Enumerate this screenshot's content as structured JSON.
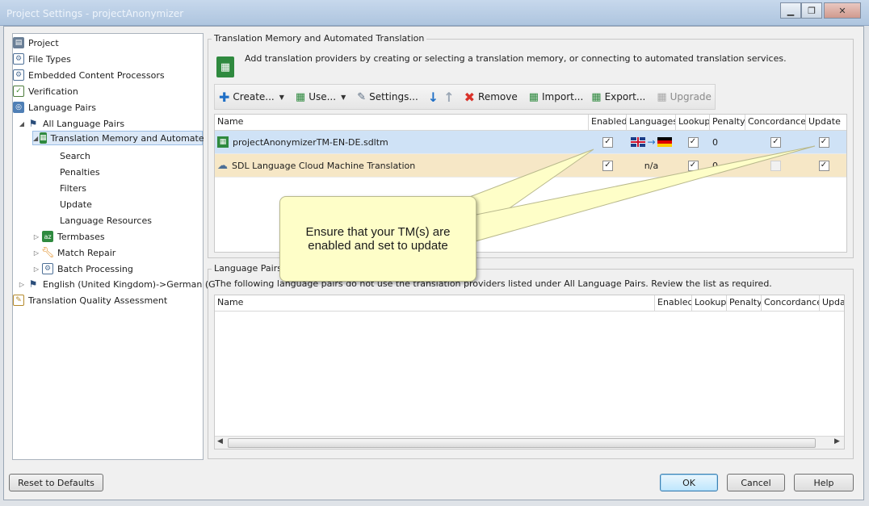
{
  "window": {
    "title": "Project Settings - projectAnonymizer",
    "controls": [
      "minimize",
      "restore",
      "close"
    ]
  },
  "tree": {
    "items": [
      {
        "label": "Project",
        "icon": "project-icon"
      },
      {
        "label": "File Types",
        "icon": "file-types-icon"
      },
      {
        "label": "Embedded Content Processors",
        "icon": "embedded-content-icon"
      },
      {
        "label": "Verification",
        "icon": "verification-icon"
      },
      {
        "label": "Language Pairs",
        "icon": "language-pairs-icon"
      },
      {
        "label": "All Language Pairs",
        "icon": "flag-icon"
      },
      {
        "label": "Translation Memory and Automate",
        "icon": "tm-icon"
      },
      {
        "label": "Search"
      },
      {
        "label": "Penalties"
      },
      {
        "label": "Filters"
      },
      {
        "label": "Update"
      },
      {
        "label": "Language Resources"
      },
      {
        "label": "Termbases",
        "icon": "termbase-icon"
      },
      {
        "label": "Match Repair",
        "icon": "wrench-icon"
      },
      {
        "label": "Batch Processing",
        "icon": "batch-icon"
      },
      {
        "label": "English (United Kingdom)->German (G",
        "icon": "flag-icon"
      },
      {
        "label": "Translation Quality Assessment",
        "icon": "quality-icon"
      }
    ]
  },
  "tm_section": {
    "title": "Translation Memory and Automated Translation",
    "description": "Add translation providers by creating or selecting a translation memory, or connecting to automated translation services.",
    "toolbar": {
      "create": "Create...",
      "use": "Use...",
      "settings": "Settings...",
      "remove": "Remove",
      "import": "Import...",
      "export": "Export...",
      "upgrade": "Upgrade"
    },
    "columns": [
      "Name",
      "Enabled",
      "Languages",
      "Lookup",
      "Penalty",
      "Concordance",
      "Update"
    ],
    "rows": [
      {
        "name": "projectAnonymizerTM-EN-DE.sdltm",
        "enabled": "✓",
        "languages": "",
        "lookup": "✓",
        "penalty": "0",
        "concordance": "✓",
        "update": "✓"
      },
      {
        "name": "SDL Language Cloud Machine Translation",
        "enabled": "✓",
        "languages": "n/a",
        "lookup": "✓",
        "penalty": "0",
        "concordance": "",
        "update": "✓"
      }
    ]
  },
  "lp_section": {
    "title": "Language Pairs",
    "description": "The following language pairs do not use the translation providers listed under All Language Pairs. Review the list as required.",
    "columns": [
      "Name",
      "Enabled",
      "Lookup",
      "Penalty",
      "Concordance",
      "Upda"
    ]
  },
  "callout": {
    "text": "Ensure that your TM(s) are enabled and set to update"
  },
  "buttons": {
    "reset": "Reset to Defaults",
    "ok": "OK",
    "cancel": "Cancel",
    "help": "Help"
  },
  "colors": {
    "selected_row": "#cfe2f6",
    "mt_row": "#f6e7c6",
    "callout_bg": "#fefec8"
  }
}
